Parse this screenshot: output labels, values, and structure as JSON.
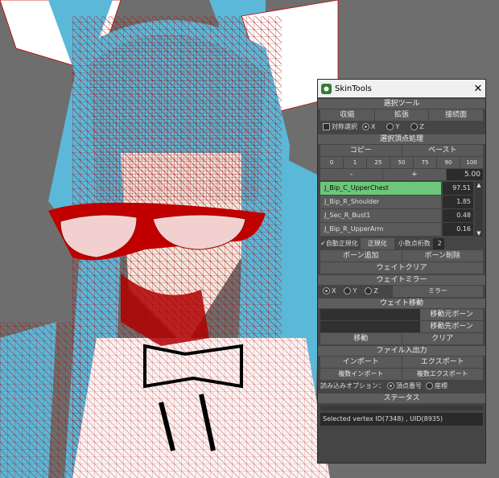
{
  "window": {
    "title": "SkinTools",
    "close_glyph": "✕"
  },
  "select_tool": {
    "header": "選択ツール",
    "buttons": [
      "収縮",
      "拡張",
      "接続面"
    ],
    "symmetry_label": "対称選択",
    "axes": [
      "X",
      "Y",
      "Z"
    ],
    "selected_axis": "X"
  },
  "vertex": {
    "header": "選択頂点処理",
    "copy_label": "コピー",
    "paste_label": "ペースト",
    "presets": [
      "0",
      "1",
      "25",
      "50",
      "75",
      "90",
      "100"
    ],
    "minus_label": "-",
    "plus_label": "+",
    "step_value": "5.00",
    "bones": [
      {
        "name": "J_Bip_C_UpperChest",
        "value": "97.51",
        "selected": true
      },
      {
        "name": "J_Bip_R_Shoulder",
        "value": "1.85",
        "selected": false
      },
      {
        "name": "J_Sec_R_Bust1",
        "value": "0.48",
        "selected": false
      },
      {
        "name": "J_Bip_R_UpperArm",
        "value": "0.16",
        "selected": false
      }
    ],
    "auto_normalize_label": "自動正規化",
    "normalize_label": "正規化",
    "decimals_label": "小数点桁数",
    "decimals_value": "2",
    "add_bone_label": "ボーン追加",
    "remove_bone_label": "ボーン削除",
    "clear_weight_label": "ウェイトクリア"
  },
  "mirror": {
    "header": "ウェイトミラー",
    "axes": [
      "X",
      "Y",
      "Z"
    ],
    "mirror_label": "ミラー"
  },
  "move": {
    "header": "ウェイト移動",
    "src_label": "移動元ボーン",
    "dst_label": "移動先ボーン",
    "move_label": "移動",
    "clear_label": "クリア"
  },
  "fileio": {
    "header": "ファイル入出力",
    "import_label": "インポート",
    "export_label": "エクスポート",
    "multi_import_label": "複数インポート",
    "multi_export_label": "複数エクスポート",
    "load_option_label": "読み込みオプション：",
    "opt_vertex_label": "頂点番号",
    "opt_coord_label": "座標"
  },
  "status": {
    "header": "ステータス",
    "message": "Selected vertex ID(7348) , UID(8935)"
  },
  "colors": {
    "accent": "#6cc77a",
    "mesh": "#c00000",
    "hair": "#5bb8d8",
    "bg": "#6e6e6e"
  }
}
